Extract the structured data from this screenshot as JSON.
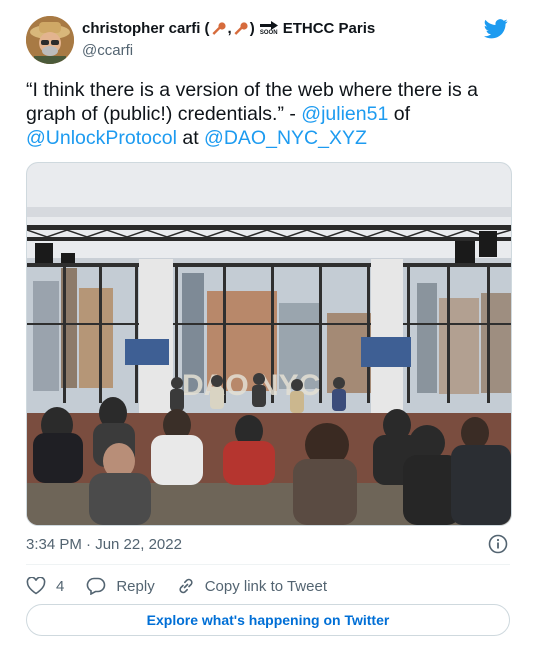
{
  "author": {
    "name_prefix": "christopher carfi (",
    "name_suffix": ")",
    "name_comma": ",",
    "soon_label": "SOON",
    "event": "ETHCC Paris",
    "handle": "@ccarfi"
  },
  "tweet": {
    "text_part1": "“I think there is a version of the web where there is a graph of (public!) credentials.” - ",
    "mention1": "@julien51",
    "text_part2": " of ",
    "mention2": "@UnlockProtocol",
    "text_part3": " at ",
    "mention3": "@DAO_NYC_XYZ"
  },
  "timestamp": "3:34 PM · Jun 22, 2022",
  "actions": {
    "like_count": "4",
    "reply_label": "Reply",
    "copy_label": "Copy link to Tweet"
  },
  "explore_label": "Explore what's happening on Twitter",
  "media_sign_text": "DAO NYC",
  "colors": {
    "accent": "#1d9bf0",
    "link": "#006fd6",
    "muted": "#536471"
  },
  "icons": [
    "key-icon",
    "right-arrow-soon-icon",
    "twitter-bird-icon",
    "info-icon",
    "heart-icon",
    "reply-icon",
    "link-icon"
  ]
}
